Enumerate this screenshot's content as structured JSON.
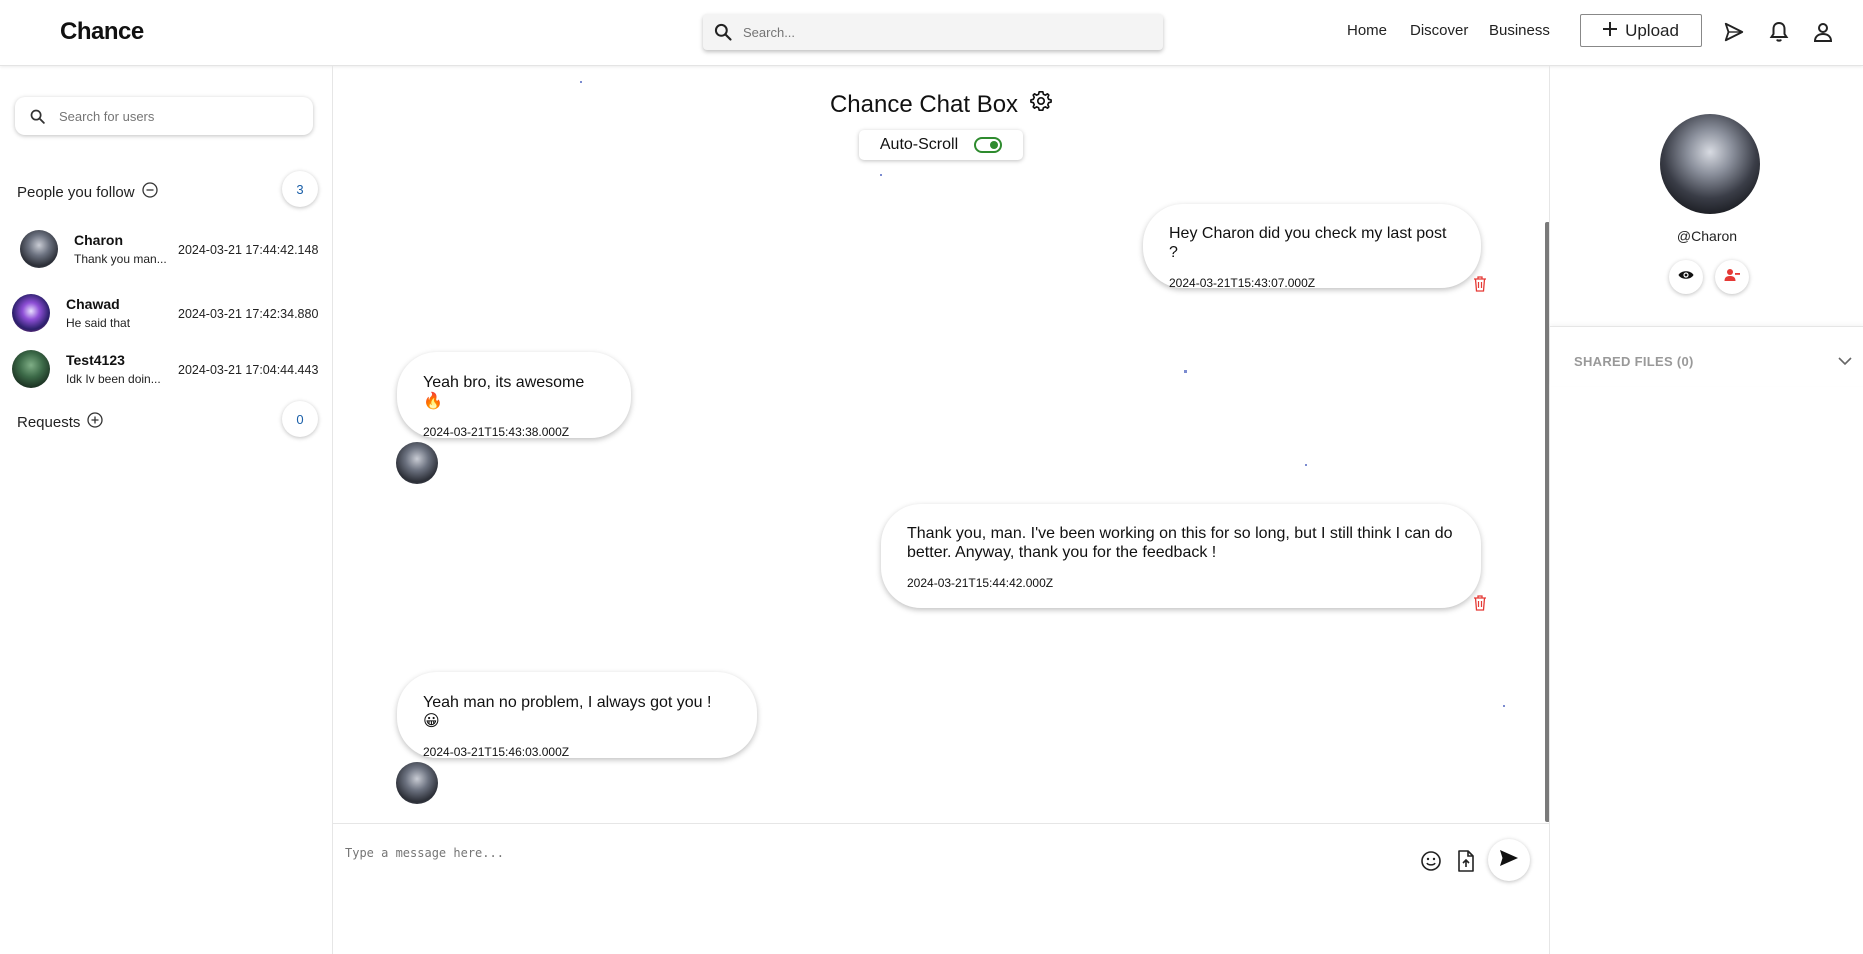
{
  "app": {
    "logo": "Chance"
  },
  "header": {
    "search_placeholder": "Search...",
    "nav": [
      "Home",
      "Discover",
      "Business"
    ],
    "upload_label": "Upload"
  },
  "sidebar": {
    "search_placeholder": "Search for users",
    "following_label": "People you follow",
    "following_count": "3",
    "requests_label": "Requests",
    "requests_count": "0",
    "contacts": [
      {
        "name": "Charon",
        "last_message": "Thank you man...",
        "time": "2024-03-21 17:44:42.148"
      },
      {
        "name": "Chawad",
        "last_message": "He said that",
        "time": "2024-03-21 17:42:34.880"
      },
      {
        "name": "Test4123",
        "last_message": "Idk Iv been doin...",
        "time": "2024-03-21 17:04:44.443"
      }
    ]
  },
  "chat": {
    "title": "Chance Chat Box",
    "autoscroll_label": "Auto-Scroll",
    "autoscroll_on": true,
    "messages": [
      {
        "from": "me",
        "text": "Hey Charon did you check my last post ?",
        "timestamp": "2024-03-21T15:43:07.000Z"
      },
      {
        "from": "Charon",
        "text": "Yeah bro, its awesome 🔥",
        "timestamp": "2024-03-21T15:43:38.000Z"
      },
      {
        "from": "me",
        "text": "Thank you, man. I've been working on this for so long, but I still think I can do better. Anyway, thank you for the feedback !",
        "timestamp": "2024-03-21T15:44:42.000Z"
      },
      {
        "from": "Charon",
        "text": "Yeah man no problem, I always got you ! 😀",
        "timestamp": "2024-03-21T15:46:03.000Z"
      }
    ],
    "composer_placeholder": "Type a message here..."
  },
  "profile": {
    "handle": "@Charon",
    "shared_files_label": "SHARED FILES (0)"
  },
  "colors": {
    "accent_blue": "#1a5fa8",
    "toggle_green": "#2e8b2e",
    "delete_red": "#e53935"
  }
}
